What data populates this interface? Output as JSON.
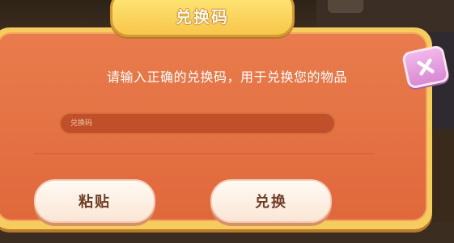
{
  "dialog": {
    "title": "兑换码",
    "instruction": "请输入正确的兑换码，用于兑换您的物品",
    "input": {
      "placeholder": "兑换码",
      "value": ""
    },
    "buttons": {
      "paste": "粘贴",
      "redeem": "兑换"
    },
    "close_icon": "close-icon"
  },
  "colors": {
    "panel": "#e87c4c",
    "frame": "#f6cc5f",
    "title_tab": "#f7c64a",
    "close_button": "#d98ad4",
    "button": "#fbe6d6"
  }
}
